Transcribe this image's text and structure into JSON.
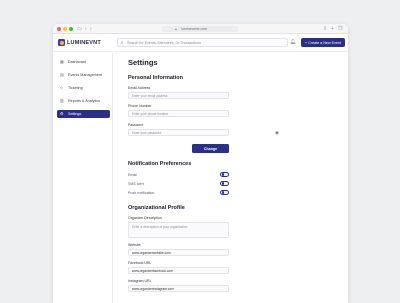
{
  "browser": {
    "url": "lumineventr.com"
  },
  "app": {
    "name": "LUMINEVNT"
  },
  "topbar": {
    "search_placeholder": "Search for Events, Attendees, Or Transactions",
    "new_event_label": "+ Create a New Event"
  },
  "sidebar": {
    "items": [
      {
        "label": "Dashboard",
        "icon": "grid-icon",
        "active": false
      },
      {
        "label": "Events Management",
        "icon": "calendar-icon",
        "active": false
      },
      {
        "label": "Ticketing",
        "icon": "ticket-icon",
        "active": false
      },
      {
        "label": "Reports & Analytics",
        "icon": "chart-icon",
        "active": false
      },
      {
        "label": "Settings",
        "icon": "gear-icon",
        "active": true
      }
    ]
  },
  "settings": {
    "title": "Settings",
    "personal": {
      "title": "Personal Information",
      "email_label": "Email Address",
      "email_placeholder": "Enter your email address",
      "phone_label": "Phone Number",
      "phone_placeholder": "Enter your phone number",
      "password_label": "Password",
      "password_placeholder": "Enter your password",
      "change_label": "Change"
    },
    "notifications": {
      "title": "Notification Preferences",
      "items": [
        {
          "label": "Email",
          "enabled": true
        },
        {
          "label": "SMS alert",
          "enabled": true
        },
        {
          "label": "Push notification",
          "enabled": true
        }
      ]
    },
    "org": {
      "title": "Organizational Profile",
      "desc_label": "Organizer Description",
      "desc_placeholder": "Enter a description of your organization",
      "website_label": "Website",
      "website_value": "www.organizerwebsite.com",
      "facebook_label": "Facebook URL",
      "facebook_value": "www.organizerfacebook.com",
      "instagram_label": "Instagram URL",
      "instagram_value": "www.organizerinstagram.com"
    }
  },
  "colors": {
    "accent": "#2b2f86",
    "logo_dot": "#f5b63a",
    "background": "#eeeff1"
  }
}
